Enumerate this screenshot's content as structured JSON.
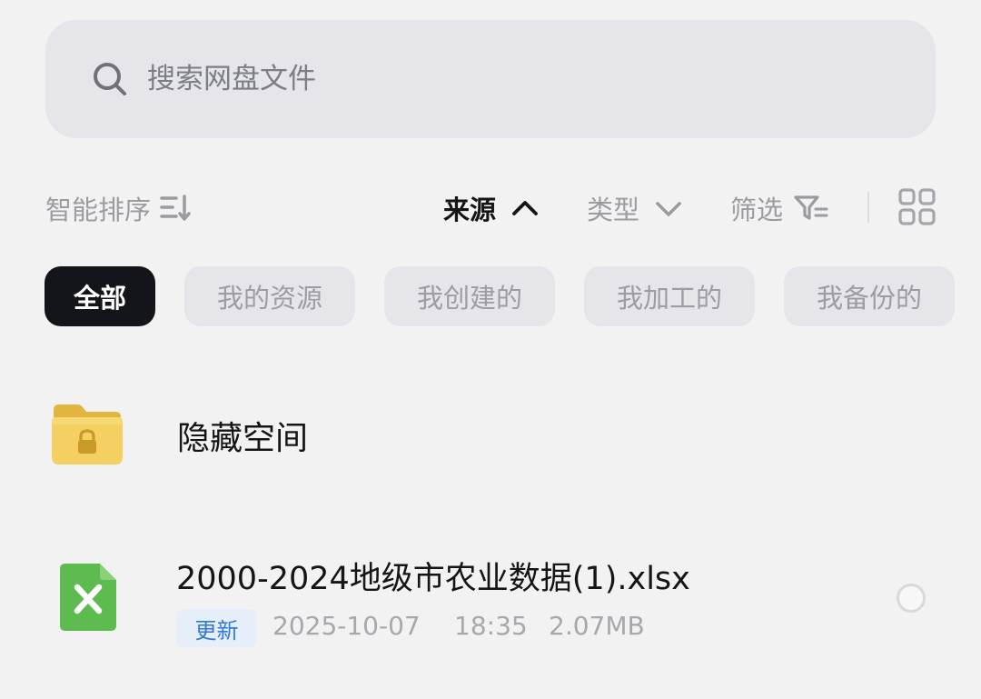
{
  "search": {
    "placeholder": "搜索网盘文件",
    "icon": "search-icon"
  },
  "toolbar": {
    "sort_label": "智能排序",
    "sort_icon": "sort-lines-icon",
    "source_label": "来源",
    "source_icon": "chevron-up-icon",
    "type_label": "类型",
    "type_icon": "chevron-down-icon",
    "filter_label": "筛选",
    "filter_icon": "filter-funnel-icon",
    "view_icon": "grid-view-icon"
  },
  "chips": [
    {
      "label": "全部",
      "active": true
    },
    {
      "label": "我的资源",
      "active": false
    },
    {
      "label": "我创建的",
      "active": false
    },
    {
      "label": "我加工的",
      "active": false
    },
    {
      "label": "我备份的",
      "active": false
    }
  ],
  "files": {
    "hidden_space": {
      "name": "隐藏空间",
      "icon": "locked-folder-icon"
    },
    "xlsx": {
      "name": "2000-2024地级市农业数据(1).xlsx",
      "icon": "excel-file-icon",
      "badge": "更新",
      "date": "2025-10-07",
      "time": "18:35",
      "size": "2.07MB"
    }
  },
  "colors": {
    "background": "#f2f2f2",
    "search_bg": "#e5e5ea",
    "active_chip": "#13151a",
    "badge_text": "#3478d5",
    "folder_yellow": "#f3cf5c",
    "excel_green": "#5dbb4f"
  }
}
